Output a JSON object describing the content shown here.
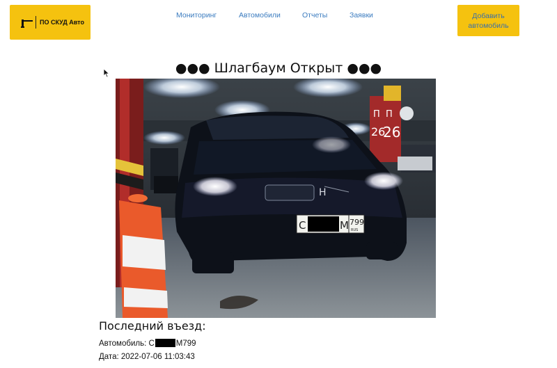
{
  "header": {
    "logo_text": "ПО СКУД Авто",
    "nav": [
      "Мониторинг",
      "Автомобили",
      "Отчеты",
      "Заявки"
    ],
    "add_button_line1": "Добавить",
    "add_button_line2": "автомобиль"
  },
  "status": {
    "text": "●●● Шлагбаум Открыт ●●●"
  },
  "photo": {
    "plate_prefix": "C",
    "plate_suffix": "M",
    "plate_region": "799",
    "country": "RUS"
  },
  "last_entry": {
    "title": "Последний въезд:",
    "car_label": "Автомобиль: ",
    "car_prefix": "C",
    "car_suffix": "M799",
    "date_text": "Дата: 2022-07-06 11:03:43"
  },
  "colors": {
    "brand_yellow": "#f5c20f",
    "link_blue": "#3a7bbf"
  }
}
